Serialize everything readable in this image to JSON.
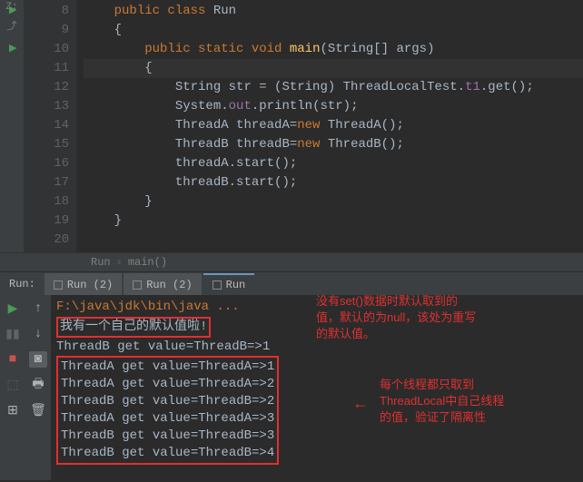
{
  "gutter": {
    "lines": [
      "8",
      "9",
      "10",
      "11",
      "12",
      "13",
      "14",
      "15",
      "16",
      "17",
      "18",
      "19",
      "20"
    ]
  },
  "code": {
    "l8": {
      "p1": "public class ",
      "p2": "Run"
    },
    "l9": "{",
    "l10": {
      "p1": "public static void ",
      "p2": "main",
      "p3": "(String[] args)"
    },
    "l11": "{",
    "l12": {
      "p1": "String str = (String) ThreadLocalTest.",
      "p2": "t1",
      "p3": ".get();"
    },
    "l13": {
      "p1": "System.",
      "p2": "out",
      "p3": ".println(str);"
    },
    "l14": {
      "p1": "ThreadA threadA=",
      "p2": "new ",
      "p3": "ThreadA();"
    },
    "l15": {
      "p1": "ThreadB threadB=",
      "p2": "new ",
      "p3": "ThreadB();"
    },
    "l16": "threadA.start();",
    "l17": "threadB.start();",
    "l18": "}",
    "l19": "}"
  },
  "breadcrumb": {
    "a": "Run",
    "b": "main()"
  },
  "runHeader": {
    "label": "Run:",
    "tab1": "Run (2)",
    "tab2": "Run (2)",
    "tab3": "Run"
  },
  "console": {
    "cmd": "F:\\java\\jdk\\bin\\java ...",
    "line1": "我有一个自己的默认值啦!",
    "line2": "ThreadB get value=ThreadB=>1",
    "box": [
      "ThreadA get value=ThreadA=>1",
      "ThreadA get value=ThreadA=>2",
      "ThreadB get value=ThreadB=>2",
      "ThreadA get value=ThreadA=>3",
      "ThreadB get value=ThreadB=>3",
      "ThreadB get value=ThreadB=>4"
    ]
  },
  "annot1": {
    "l1": "没有set()数据时默认取到的",
    "l2": "值，默认的为null，该处为重写",
    "l3": "的默认值。"
  },
  "annot2": {
    "l1": "每个线程都只取到",
    "l2": "ThreadLocal中自己线程",
    "l3": "的值，验证了隔离性"
  },
  "arrow": "←"
}
